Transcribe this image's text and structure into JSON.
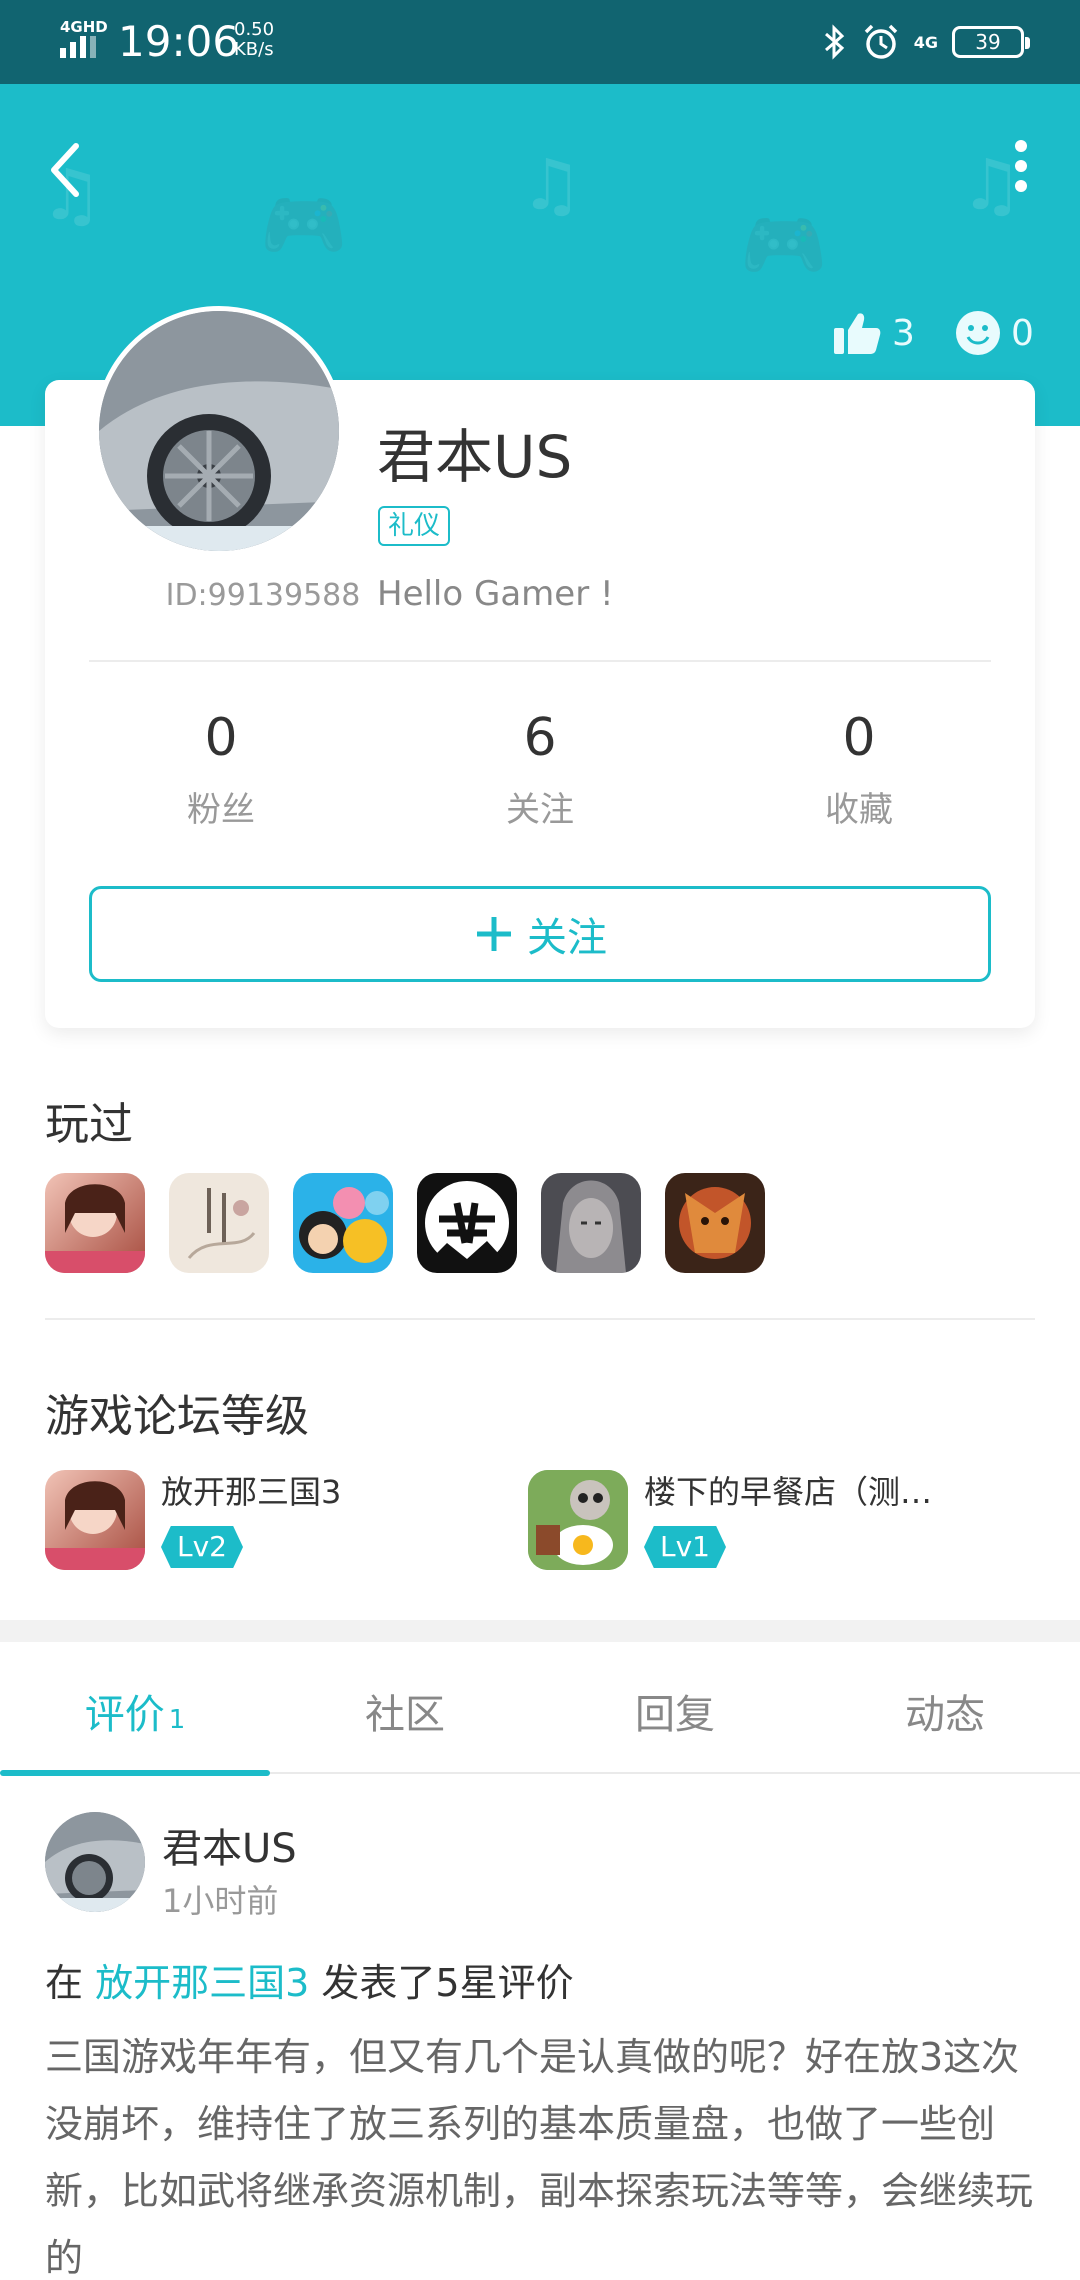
{
  "status_bar": {
    "network": "4GHD",
    "time": "19:06",
    "speed_value": "0.50",
    "speed_unit": "KB/s",
    "net2": "4G",
    "battery": "39",
    "icons": [
      "signal-icon",
      "bluetooth-icon",
      "alarm-icon",
      "mobile-data-icon",
      "battery-icon"
    ]
  },
  "header": {
    "bg_color": "#1cbcc9",
    "likes": "3",
    "smiles": "0"
  },
  "profile": {
    "username": "君本US",
    "title_badge": "礼仪",
    "bio": "Hello Gamer !",
    "id_text": "ID:99139588",
    "stats": [
      {
        "value": "0",
        "label": "粉丝"
      },
      {
        "value": "6",
        "label": "关注"
      },
      {
        "value": "0",
        "label": "收藏"
      }
    ],
    "follow_label": "关注"
  },
  "played": {
    "title": "玩过",
    "games": [
      "game-1",
      "game-2",
      "game-3",
      "game-4",
      "game-5",
      "game-6"
    ]
  },
  "forum": {
    "title": "游戏论坛等级",
    "items": [
      {
        "name": "放开那三国3",
        "level": "Lv2"
      },
      {
        "name": "楼下的早餐店（测…",
        "level": "Lv1"
      }
    ]
  },
  "tabs": [
    {
      "label": "评价",
      "count": "1"
    },
    {
      "label": "社区",
      "count": ""
    },
    {
      "label": "回复",
      "count": ""
    },
    {
      "label": "动态",
      "count": ""
    }
  ],
  "review": {
    "author": "君本US",
    "time": "1小时前",
    "prefix": "在",
    "game": "放开那三国3",
    "suffix": "发表了5星评价",
    "body": "三国游戏年年有，但又有几个是认真做的呢？好在放3这次没崩坏，维持住了放三系列的基本质量盘，也做了一些创新，比如武将继承资源机制，副本探索玩法等等，会继续玩的"
  }
}
